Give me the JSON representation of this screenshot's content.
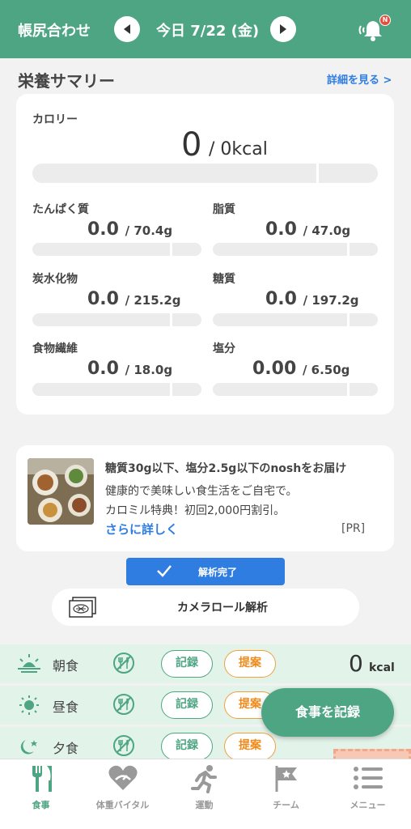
{
  "header": {
    "title": "帳尻合わせ",
    "date": "今日 7/22 (金)",
    "badge": "N"
  },
  "summary": {
    "title": "栄養サマリー",
    "detail_link": "詳細を見る >",
    "calorie": {
      "label": "カロリー",
      "value": "0",
      "unit": "/ 0kcal"
    },
    "nutrients": [
      {
        "label": "たんぱく質",
        "value": "0.0",
        "target": "/ 70.4g"
      },
      {
        "label": "脂質",
        "value": "0.0",
        "target": "/ 47.0g"
      },
      {
        "label": "炭水化物",
        "value": "0.0",
        "target": "/ 215.2g"
      },
      {
        "label": "糖質",
        "value": "0.0",
        "target": "/ 197.2g"
      },
      {
        "label": "食物繊維",
        "value": "0.0",
        "target": "/ 18.0g"
      },
      {
        "label": "塩分",
        "value": "0.00",
        "target": "/ 6.50g"
      }
    ]
  },
  "ad": {
    "headline": "糖質30g以下、塩分2.5g以下のnoshをお届け",
    "line1": "健康的で美味しい食生活をご自宅で。",
    "line2": "カロミル特典！初回2,000円割引。",
    "more": "さらに詳しく",
    "pr": "[PR]"
  },
  "analysis": {
    "status": "解析完了",
    "camera_roll": "カメラロール解析"
  },
  "meals": [
    {
      "name": "朝食",
      "record": "記録",
      "suggest": "提案",
      "kcal": "0",
      "unit": "kcal"
    },
    {
      "name": "昼食",
      "record": "記録",
      "suggest": "提案"
    },
    {
      "name": "夕食",
      "record": "記録",
      "suggest": "提案"
    }
  ],
  "fab": {
    "label": "食事を記録"
  },
  "tabs": [
    {
      "label": "食事",
      "icon": "fork-knife-icon"
    },
    {
      "label": "体重バイタル",
      "icon": "heart-scale-icon"
    },
    {
      "label": "運動",
      "icon": "runner-icon"
    },
    {
      "label": "チーム",
      "icon": "flag-star-icon"
    },
    {
      "label": "メニュー",
      "icon": "menu-list-icon"
    }
  ],
  "colors": {
    "brand": "#4ea583",
    "link": "#2f7de1",
    "suggest": "#f08a1a",
    "highlight": "#f7c8b4"
  }
}
